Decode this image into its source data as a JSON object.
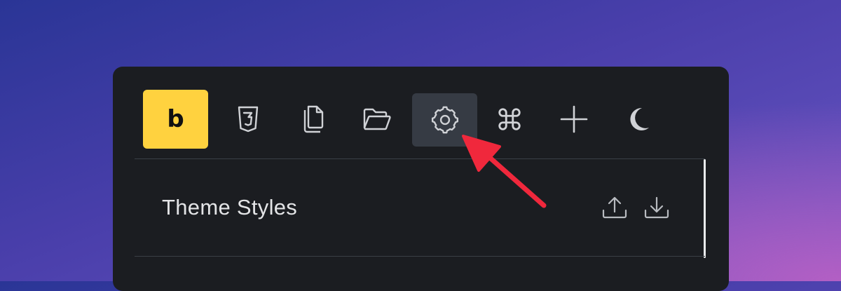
{
  "toolbar": {
    "logo_letter": "b",
    "logo_color": "#ffd23f",
    "buttons": [
      {
        "icon": "css3-icon"
      },
      {
        "icon": "pages-icon"
      },
      {
        "icon": "folder-icon"
      },
      {
        "icon": "gear-icon",
        "active": true
      },
      {
        "icon": "command-icon"
      },
      {
        "icon": "plus-icon"
      },
      {
        "icon": "moon-icon"
      }
    ]
  },
  "section": {
    "title": "Theme Styles",
    "actions": [
      {
        "icon": "upload-icon"
      },
      {
        "icon": "download-icon"
      }
    ]
  },
  "annotation": {
    "icon": "red-arrow-icon",
    "color": "#f0283c"
  }
}
